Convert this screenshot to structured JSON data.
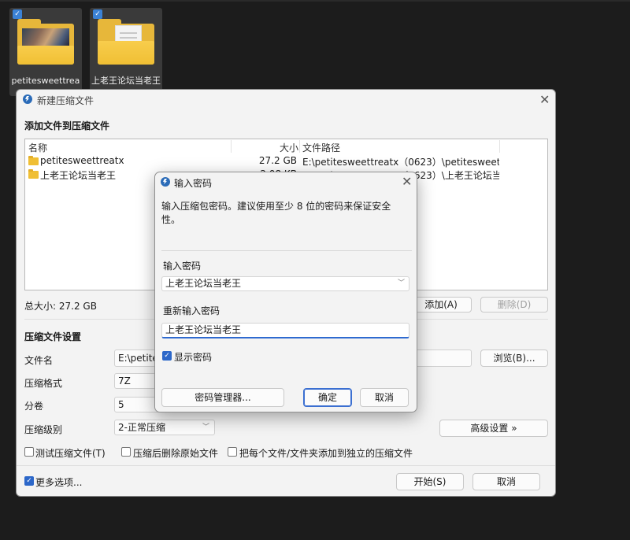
{
  "desktop": {
    "icons": [
      {
        "label": "petitesweettrea"
      },
      {
        "label": "上老王论坛当老王"
      }
    ],
    "check_mark": "✓"
  },
  "main_dialog": {
    "title": "新建压缩文件",
    "close": "✕",
    "section_add": "添加文件到压缩文件",
    "columns": {
      "name": "名称",
      "size": "大小",
      "path": "文件路径"
    },
    "files": [
      {
        "name": "petitesweettreatx",
        "size": "27.2 GB",
        "path": "E:\\petitesweettreatx（0623）\\petitesweettre..."
      },
      {
        "name": "上老王论坛当老王",
        "size": "2.08 KB",
        "path": "E:\\petitesweettreatx（0623）\\上老王论坛当老..."
      }
    ],
    "total_size": "总大小: 27.2 GB",
    "add_button": "添加(A)",
    "delete_button": "删除(D)",
    "section_settings": "压缩文件设置",
    "filename_label": "文件名",
    "filename_value": "E:\\petites",
    "browse_button": "浏览(B)...",
    "format_label": "压缩格式",
    "format_value": "7Z",
    "split_label": "分卷",
    "split_value": "5",
    "level_label": "压缩级别",
    "level_value": "2-正常压缩",
    "advanced_button": "高级设置 »",
    "opt_test": "测试压缩文件(T)",
    "opt_delete": "压缩后删除原始文件",
    "opt_each": "把每个文件/文件夹添加到独立的压缩文件",
    "more_options": "更多选项...",
    "start_button": "开始(S)",
    "cancel_button": "取消"
  },
  "password_dialog": {
    "title": "输入密码",
    "close": "✕",
    "info": "输入压缩包密码。建议使用至少 8 位的密码来保证安全性。",
    "password_label": "输入密码",
    "password_value": "上老王论坛当老王",
    "reenter_label": "重新输入密码",
    "reenter_value": "上老王论坛当老王",
    "show_password_label": "显示密码",
    "show_password_checked": true,
    "manager_button": "密码管理器...",
    "ok_button": "确定",
    "cancel_button": "取消"
  },
  "colors": {
    "accent": "#2c67c9",
    "folder": "#f0bf34",
    "desktop_bg": "#1c1c1c"
  }
}
